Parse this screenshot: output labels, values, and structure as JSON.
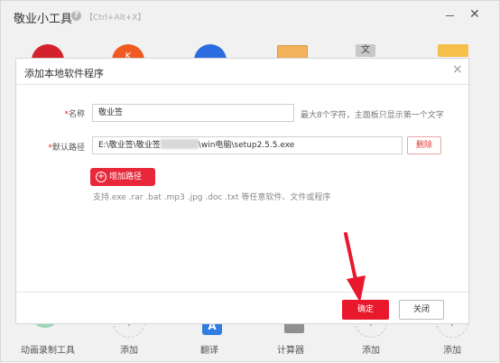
{
  "window": {
    "title": "敬业小工具",
    "help_icon": "question-icon",
    "shortcut": "【Ctrl+Alt+X】"
  },
  "bottom_bar": {
    "items": [
      {
        "label": "动画录制工具"
      },
      {
        "label": "添加"
      },
      {
        "label": "翻译",
        "glyph": "A"
      },
      {
        "label": "计算器"
      },
      {
        "label": "添加"
      },
      {
        "label": "添加"
      }
    ],
    "plus": "+"
  },
  "top_row_glyphs": {
    "k": "K",
    "wen": "文"
  },
  "dialog": {
    "title": "添加本地软件程序",
    "close_glyph": "×",
    "required_mark": "*",
    "name_label": "名称",
    "name_value": "敬业签",
    "name_hint": "最大8个字符，主面板只显示第一个文字",
    "path_label": "默认路径",
    "path_value_prefix": "E:\\敬业签\\敬业签",
    "path_value_suffix": "\\win电脑\\setup2.5.5.exe",
    "delete_label": "删除",
    "add_path_label": "增加路径",
    "add_path_glyph": "+",
    "support_text": "支持.exe .rar .bat .mp3 .jpg .doc .txt 等任意软件、文件或程序",
    "ok_label": "确定",
    "close_label": "关闭"
  },
  "colors": {
    "primary_red": "#e8192c",
    "dialog_bg": "#ffffff",
    "window_bg": "#f1f1f1"
  }
}
